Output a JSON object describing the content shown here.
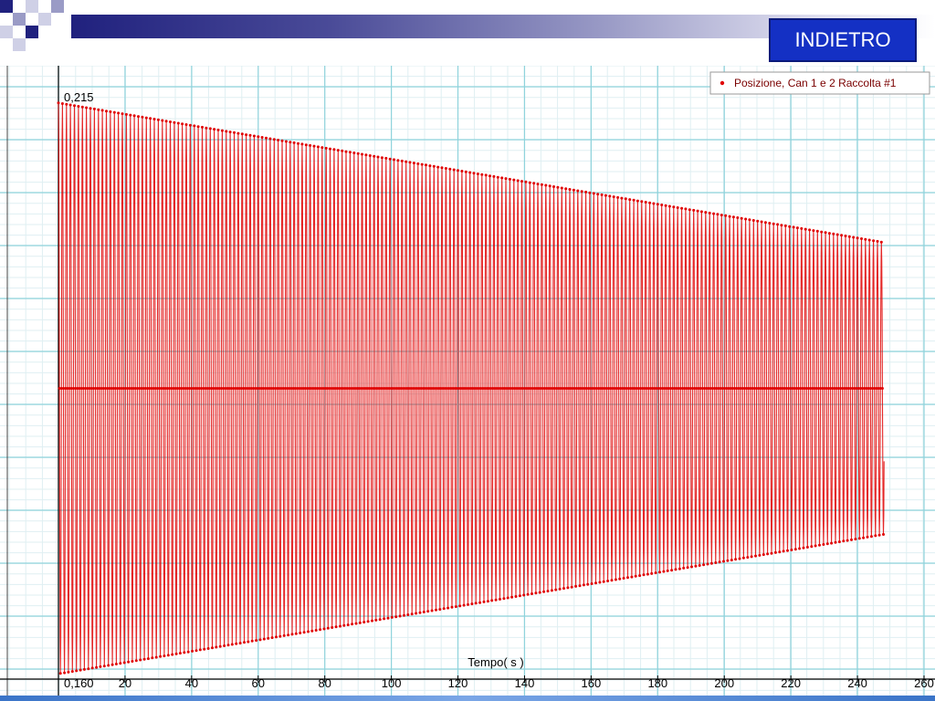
{
  "nav": {
    "back_label": "INDIETRO"
  },
  "colors": {
    "series": "#e00000",
    "grid": "#8fd3dc",
    "header_dark": "#20217e",
    "button": "#1430c4"
  },
  "chart_data": {
    "type": "scatter",
    "xlabel": "Tempo( s )",
    "ylabel": "",
    "xlim": [
      0,
      260
    ],
    "ylim": [
      0.16,
      0.215
    ],
    "x_ticks": [
      "20",
      "40",
      "60",
      "80",
      "100",
      "120",
      "140",
      "160",
      "180",
      "200",
      "220",
      "240",
      "260"
    ],
    "y_tick_labels": [
      "0,160",
      "0,215"
    ],
    "grid": true,
    "legend_position": "top-right",
    "series": [
      {
        "name": "Posizione, Can 1 e 2 Raccolta #1",
        "description_points": [
          [
            0,
            0.2145
          ],
          [
            0,
            0.1605
          ],
          [
            50,
            0.2115
          ],
          [
            50,
            0.1635
          ],
          [
            100,
            0.2085
          ],
          [
            100,
            0.1665
          ],
          [
            150,
            0.206
          ],
          [
            150,
            0.169
          ],
          [
            200,
            0.2035
          ],
          [
            200,
            0.1715
          ],
          [
            248,
            0.201
          ],
          [
            248,
            0.1735
          ]
        ],
        "period_s": 1.2,
        "equilibrium": 0.1875,
        "amplitude_start": 0.027,
        "amplitude_end": 0.0138,
        "t_start": 0,
        "t_end": 248
      }
    ]
  }
}
